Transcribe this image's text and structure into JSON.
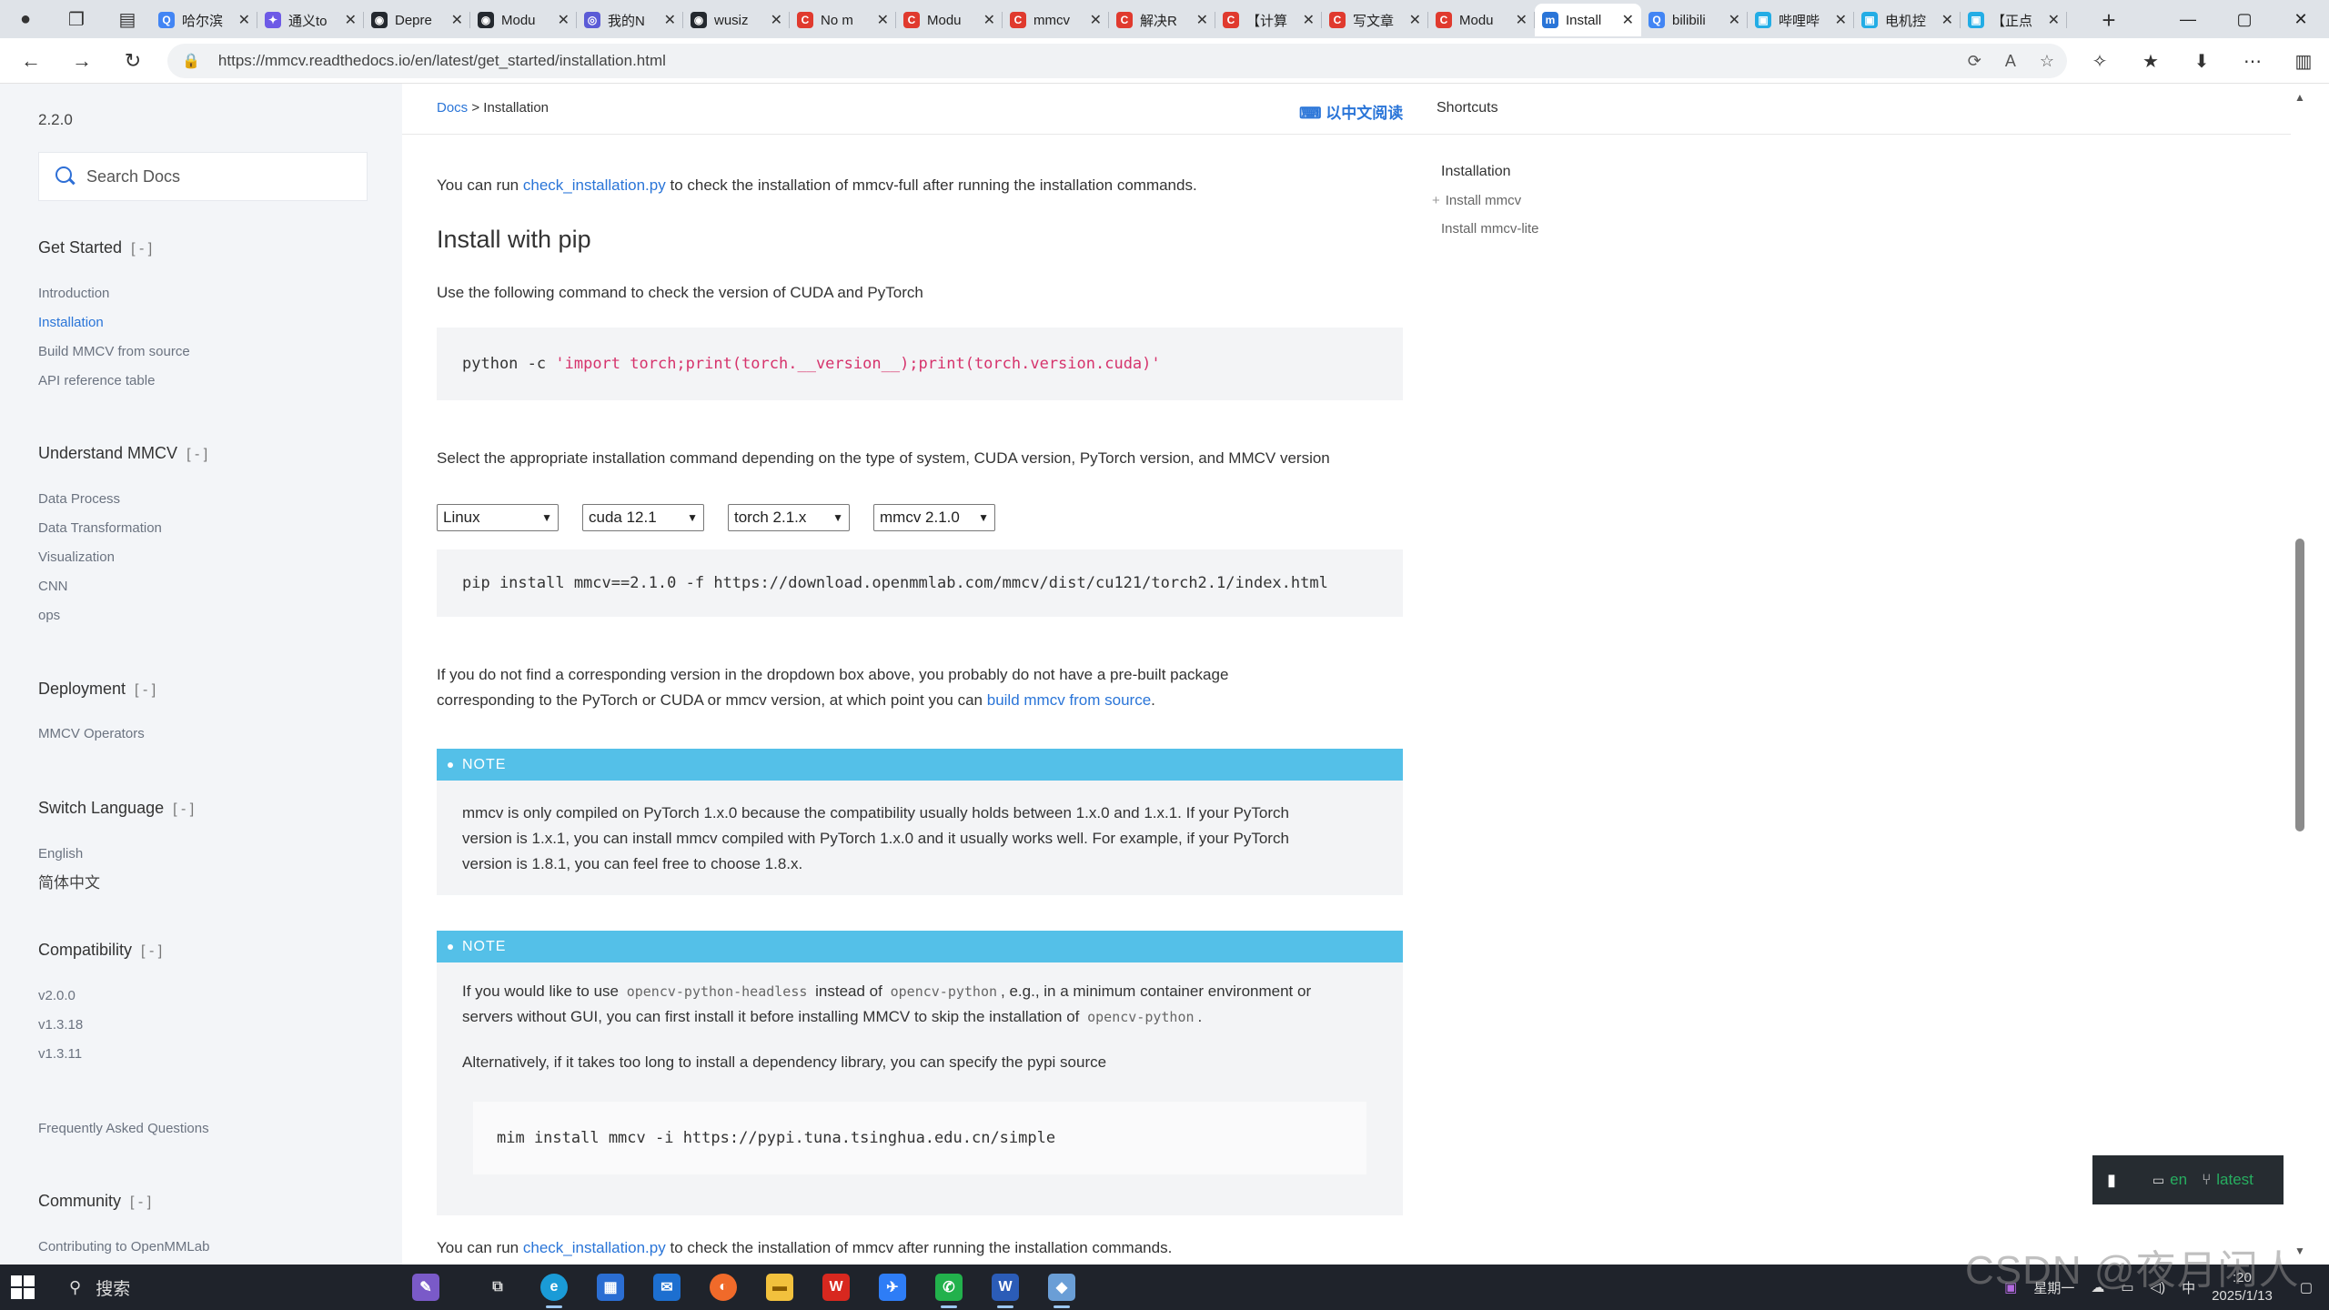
{
  "browser": {
    "tabs": [
      {
        "title": "哈尔滨",
        "color": "#4285f4",
        "glyph": "Q"
      },
      {
        "title": "通义to",
        "color": "#6d5ae6",
        "glyph": "✦"
      },
      {
        "title": "Depre",
        "color": "#24292f",
        "glyph": "◉"
      },
      {
        "title": "Modu",
        "color": "#24292f",
        "glyph": "◉"
      },
      {
        "title": "我的N",
        "color": "#5b5bd6",
        "glyph": "◎"
      },
      {
        "title": "wusiz",
        "color": "#24292f",
        "glyph": "◉"
      },
      {
        "title": "No m",
        "color": "#e03a2e",
        "glyph": "C"
      },
      {
        "title": "Modu",
        "color": "#e03a2e",
        "glyph": "C"
      },
      {
        "title": "mmcv",
        "color": "#e03a2e",
        "glyph": "C"
      },
      {
        "title": "解决R",
        "color": "#e03a2e",
        "glyph": "C"
      },
      {
        "title": "【计算",
        "color": "#e03a2e",
        "glyph": "C"
      },
      {
        "title": "写文章",
        "color": "#e03a2e",
        "glyph": "C"
      },
      {
        "title": "Modu",
        "color": "#e03a2e",
        "glyph": "C"
      },
      {
        "title": "Install",
        "color": "#2a75d8",
        "glyph": "m"
      },
      {
        "title": "bilibili",
        "color": "#4285f4",
        "glyph": "Q"
      },
      {
        "title": "哔哩哔",
        "color": "#23ade5",
        "glyph": "▣"
      },
      {
        "title": "电机控",
        "color": "#23ade5",
        "glyph": "▣"
      },
      {
        "title": "【正点",
        "color": "#23ade5",
        "glyph": "▣"
      }
    ],
    "active_tab_index": 13,
    "url": "https://mmcv.readthedocs.io/en/latest/get_started/installation.html"
  },
  "sidebar": {
    "version": "2.2.0",
    "search_placeholder": "Search Docs",
    "toggle": "[ - ]",
    "sections": {
      "get_started": {
        "title": "Get Started",
        "items": [
          "Introduction",
          "Installation",
          "Build MMCV from source",
          "API reference table"
        ]
      },
      "understand": {
        "title": "Understand MMCV",
        "items": [
          "Data Process",
          "Data Transformation",
          "Visualization",
          "CNN",
          "ops"
        ]
      },
      "deployment": {
        "title": "Deployment",
        "items": [
          "MMCV Operators"
        ]
      },
      "switch_language": {
        "title": "Switch Language",
        "items": [
          "English",
          "简体中文"
        ]
      },
      "compatibility": {
        "title": "Compatibility",
        "items": [
          "v2.0.0",
          "v1.3.18",
          "v1.3.11"
        ]
      },
      "faq": "Frequently Asked Questions",
      "community": {
        "title": "Community",
        "items": [
          "Contributing to OpenMMLab"
        ]
      }
    }
  },
  "topbar": {
    "breadcrumb_link": "Docs",
    "breadcrumb_sep": ">",
    "breadcrumb_current": "Installation",
    "read_in_chinese": "以中文阅读",
    "shortcuts": "Shortcuts"
  },
  "toc": {
    "head": "Installation",
    "items": [
      "Install mmcv",
      "Install mmcv-lite"
    ]
  },
  "article": {
    "p1_pre": "You can run",
    "p1_link": "check_installation.py",
    "p1_post": "to check the installation of mmcv-full after running the installation commands.",
    "heading": "Install with pip",
    "p2": "Use the following command to check the version of CUDA and PyTorch",
    "code1_cmd": "python -c",
    "code1_str": "'import torch;print(torch.__version__);print(torch.version.cuda)'",
    "p3": "Select the appropriate installation command depending on the type of system, CUDA version, PyTorch version, and MMCV version",
    "selects": {
      "system": "Linux",
      "cuda": "cuda 12.1",
      "torch": "torch 2.1.x",
      "mmcv": "mmcv 2.1.0"
    },
    "code2": "pip install mmcv==2.1.0 -f https://download.openmmlab.com/mmcv/dist/cu121/torch2.1/index.html",
    "p4_line1": "If you do not find a corresponding version in the dropdown box above, you probably do not have a pre-built package",
    "p4_line2_pre": "corresponding to the PyTorch or CUDA or mmcv version, at which point you can",
    "p4_link": "build mmcv from source",
    "p4_post": ".",
    "note_label": "NOTE",
    "note1_line1": "mmcv is only compiled on PyTorch 1.x.0 because the compatibility usually holds between 1.x.0 and 1.x.1. If your PyTorch",
    "note1_line2": "version is 1.x.1, you can install mmcv compiled with PyTorch 1.x.0 and it usually works well. For example, if your PyTorch",
    "note1_line3": "version is 1.8.1, you can feel free to choose 1.8.x.",
    "note2_a": "If you would like to use",
    "note2_code1": "opencv-python-headless",
    "note2_b": "instead of",
    "note2_code2": "opencv-python",
    "note2_c": ", e.g., in a minimum container environment or",
    "note2_d": "servers without GUI, you can first install it before installing MMCV to skip the installation of",
    "note2_code3": "opencv-python",
    "note2_e": ".",
    "note2_p2": "Alternatively, if it takes too long to install a dependency library, you can specify the pypi source",
    "note2_code": "mim install mmcv -i https://pypi.tuna.tsinghua.edu.cn/simple",
    "p5_pre": "You can run",
    "p5_link": "check_installation.py",
    "p5_post": "to check the installation of mmcv after running the installation commands."
  },
  "rtd_badge": {
    "lang": "en",
    "branch": "latest"
  },
  "taskbar": {
    "search_label": "搜索",
    "weekday": "星期一",
    "time": ":20",
    "date": "2025/1/13",
    "watermark": "CSDN @夜月闲人"
  }
}
